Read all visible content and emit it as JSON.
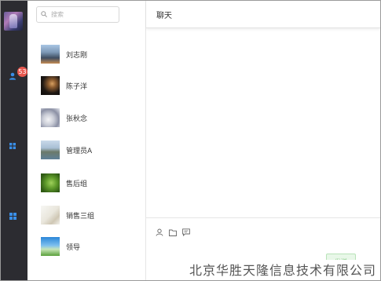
{
  "search": {
    "placeholder": "搜索",
    "value": ""
  },
  "rail": {
    "badge_count": "53"
  },
  "contacts": [
    {
      "name": "刘志刚",
      "avatar": "city-skyline"
    },
    {
      "name": "陈子洋",
      "avatar": "dark-room"
    },
    {
      "name": "张秋念",
      "avatar": "white-flower"
    },
    {
      "name": "管理员A",
      "avatar": "mountain-lake"
    },
    {
      "name": "售后组",
      "avatar": "green-leaf"
    },
    {
      "name": "销售三组",
      "avatar": "sketch"
    },
    {
      "name": "领导",
      "avatar": "blue-sky-grass"
    }
  ],
  "chat": {
    "title": "聊天",
    "send_label": "发送"
  },
  "watermark": "北京华胜天隆信息技术有限公司",
  "colors": {
    "rail_bg": "#2c2c31",
    "rail_icon": "#3a8ee6",
    "badge": "#e8584f",
    "send_bg": "#e8f7e8"
  }
}
